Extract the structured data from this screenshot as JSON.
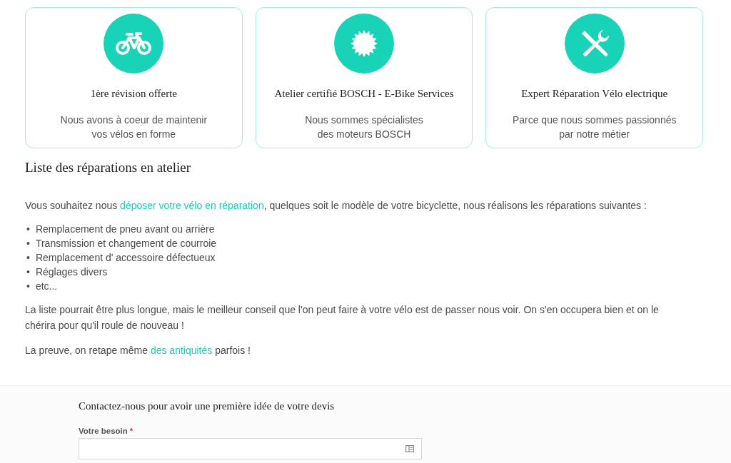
{
  "features": [
    {
      "title": "1ère révision offerte",
      "description": [
        "Nous avons à coeur de maintenir",
        "vos vélos en forme"
      ]
    },
    {
      "title": "Atelier certifié BOSCH - E-Bike Services",
      "description": [
        "Nous sommes spécialistes",
        "des moteurs BOSCH"
      ]
    },
    {
      "title": "Expert Réparation Vélo electrique",
      "description": [
        "Parce que nous sommes passionnés",
        "par notre métier"
      ]
    }
  ],
  "section_title": "Liste des réparations en atelier",
  "intro": {
    "before": "Vous souhaitez nous ",
    "link": "déposer votre vélo en réparation",
    "after": ", quelques soit le modèle de votre bicyclette, nous réalisons les réparations suivantes :"
  },
  "repairs": [
    {
      "bullet": "•",
      "text": "Remplacement de pneu avant ou arrière"
    },
    {
      "bullet": "•",
      "text": "Transmission et changement de courroie"
    },
    {
      "bullet": "•",
      "text": "Remplacement d' accessoire défectueux"
    },
    {
      "bullet": "•",
      "text": "Réglages divers"
    },
    {
      "bullet": "•",
      "text": "etc..."
    }
  ],
  "advice": "La liste pourrait être plus longue, mais le meilleur conseil que l'on peut faire à votre vélo est de passer nous voir. On s'en occupera bien et on le chérira pour qu'il roule de nouveau !",
  "proof": {
    "before": "La preuve, on retape même ",
    "link": "des antiquités",
    "after": " parfois !"
  },
  "contact": {
    "title": "Contactez-nous pour avoir une première idée de votre devis",
    "field_label": "Votre besoin",
    "required_mark": "*"
  }
}
